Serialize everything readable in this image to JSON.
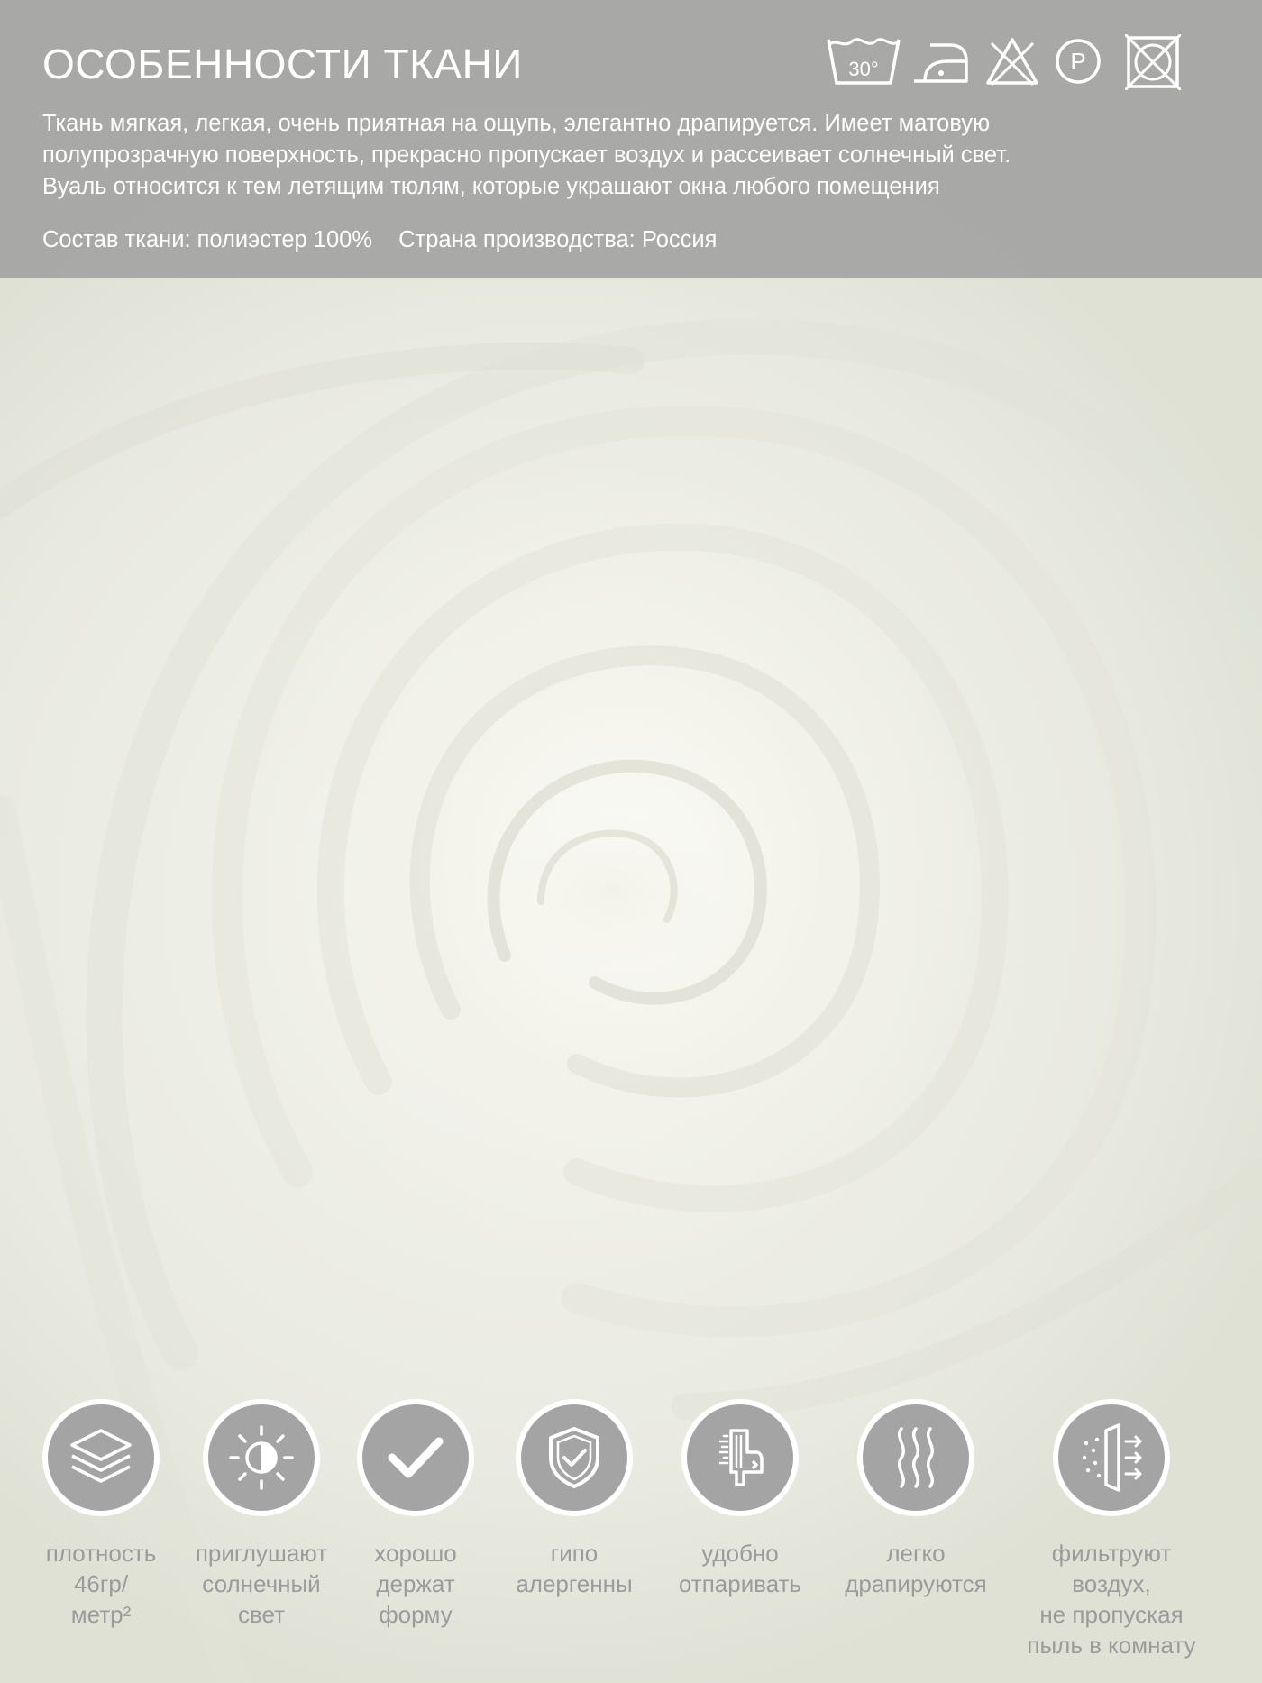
{
  "header": {
    "title": "ОСОБЕННОСТИ ТКАНИ",
    "description_lines": [
      "Ткань мягкая, легкая, очень приятная на ощупь, элегантно драпируется. Имеет матовую",
      "полупрозрачную поверхность, прекрасно пропускает воздух и рассеивает солнечный свет.",
      "Вуаль относится к тем летящим тюлям, которые украшают окна любого помещения"
    ],
    "composition": "Состав ткани: полиэстер 100%",
    "country": "Страна производства: Россия"
  },
  "care_icons": [
    {
      "icon": "wash-30-icon",
      "text": "30°"
    },
    {
      "icon": "iron-low-icon"
    },
    {
      "icon": "no-bleach-icon"
    },
    {
      "icon": "dry-clean-p-icon",
      "text": "P"
    },
    {
      "icon": "no-tumble-dry-icon"
    }
  ],
  "features": [
    {
      "icon": "layers-icon",
      "label": "плотность\n46гр/\nметр²"
    },
    {
      "icon": "sun-shade-icon",
      "label": "приглушают\nсолнечный\nсвет"
    },
    {
      "icon": "checkmark-icon",
      "label": "хорошо\nдержат\nформу"
    },
    {
      "icon": "shield-check-icon",
      "label": "гипо\nалергенны"
    },
    {
      "icon": "steamer-icon",
      "label": "удобно\nотпаривать"
    },
    {
      "icon": "waves-icon",
      "label": "легко\nдрапируются"
    },
    {
      "icon": "air-filter-icon",
      "label": "фильтруют воздух,\nне пропуская\nпыль в комнату"
    }
  ],
  "colors": {
    "header_bg": "#a0a0a0",
    "icon_circle": "#a4a4a4",
    "label_text": "#9b9b9b",
    "fabric": "#f2f2ea"
  }
}
